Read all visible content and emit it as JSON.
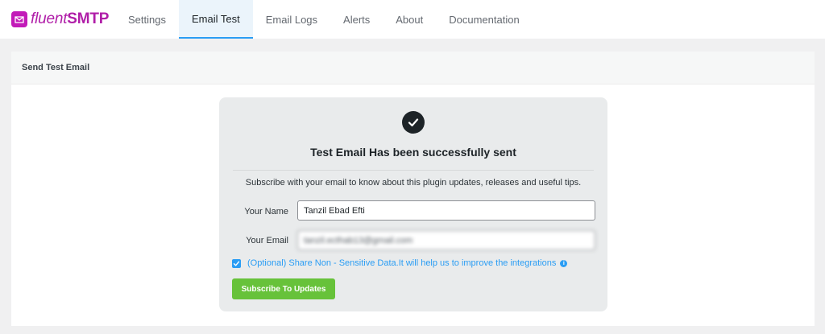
{
  "brand": {
    "prefix": "fluent",
    "suffix": "SMTP",
    "accent": "#b01ea8"
  },
  "nav": {
    "items": [
      {
        "label": "Settings"
      },
      {
        "label": "Email Test"
      },
      {
        "label": "Email Logs"
      },
      {
        "label": "Alerts"
      },
      {
        "label": "About"
      },
      {
        "label": "Documentation"
      }
    ],
    "active": "Email Test"
  },
  "panel": {
    "title": "Send Test Email"
  },
  "result": {
    "icon": "check-circle-icon",
    "title": "Test Email Has been successfully sent",
    "subscribe_text": "Subscribe with your email to know about this plugin updates, releases and useful tips."
  },
  "form": {
    "name_label": "Your Name",
    "name_value": "Tanzil Ebad Efti",
    "email_label": "Your Email",
    "email_value": "tanzil.ecthab13@gmail.com",
    "optional_text": "(Optional) Share Non - Sensitive Data.It will help us to improve the integrations",
    "optional_checked": true,
    "subscribe_button": "Subscribe To Updates"
  },
  "colors": {
    "accent_blue": "#2a9df4",
    "button_green": "#67c23a"
  }
}
